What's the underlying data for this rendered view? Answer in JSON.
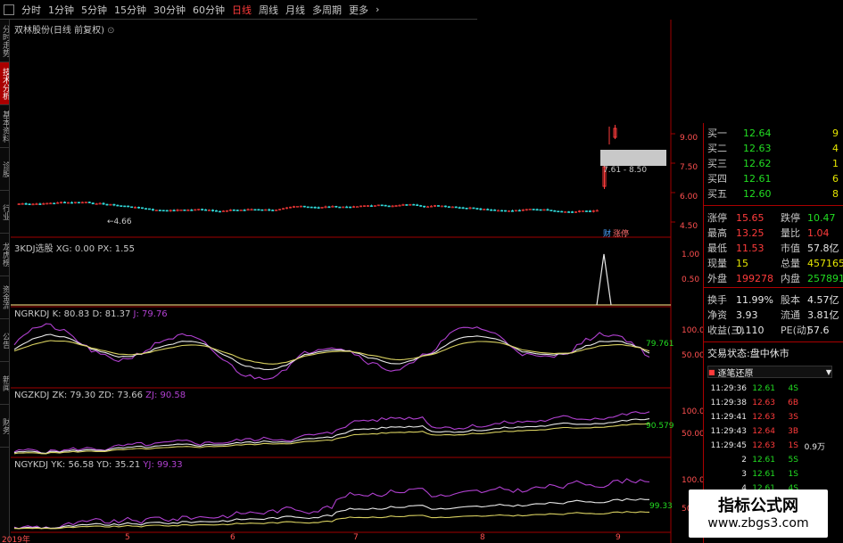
{
  "toolbar": {
    "items": [
      "分时",
      "1分钟",
      "5分钟",
      "15分钟",
      "30分钟",
      "60分钟",
      "日线",
      "周线",
      "月线",
      "多周期",
      "更多"
    ],
    "active_index": 6
  },
  "leftnav": {
    "items": [
      "分时走势",
      "技术分析",
      "基本资料",
      "诊股",
      "行业",
      "龙虎榜",
      "资金流",
      "公告",
      "新闻",
      "财务"
    ],
    "active_index": 1
  },
  "main_title": "双林股份(日线 前复权)",
  "price_axis": [
    "9.00",
    "7.50",
    "6.00",
    "4.50"
  ],
  "low_label": "4.66",
  "range_label": "7.61 - 8.50",
  "badge_left": "财",
  "badge_right": "涨停",
  "p2": {
    "title": "3KDJ选股 XG: 0.00 PX: 1.55",
    "axis": [
      "1.00",
      "0.50"
    ]
  },
  "p3": {
    "title": "NGRKDJ K: 80.83 D: 81.37",
    "j": "J: 79.76",
    "axis": [
      "100.0",
      "50.00"
    ],
    "last": "79.761"
  },
  "p4": {
    "title": "NGZKDJ ZK: 79.30 ZD: 73.66",
    "j": "ZJ: 90.58",
    "axis": [
      "100.0",
      "50.00"
    ],
    "last": "90.579"
  },
  "p5": {
    "title": "NGYKDJ YK: 56.58 YD: 35.21",
    "j": "YJ: 99.33",
    "axis": [
      "100.0",
      "50.00"
    ],
    "last": "99.33"
  },
  "date_axis": [
    "2019年",
    "5",
    "6",
    "7",
    "8",
    "9"
  ],
  "quote": {
    "top_ticks": [
      "9",
      "4",
      "1",
      "6",
      "8"
    ],
    "book": [
      {
        "label": "买一",
        "price": "12.64"
      },
      {
        "label": "买二",
        "price": "12.63"
      },
      {
        "label": "买三",
        "price": "12.62"
      },
      {
        "label": "买四",
        "price": "12.61"
      },
      {
        "label": "买五",
        "price": "12.60"
      }
    ],
    "stats": [
      {
        "l1": "涨停",
        "v1": "15.65",
        "c1": "red",
        "l2": "跌停",
        "v2": "10.47",
        "c2": "green"
      },
      {
        "l1": "最高",
        "v1": "13.25",
        "c1": "red",
        "l2": "量比",
        "v2": "1.04",
        "c2": "red"
      },
      {
        "l1": "最低",
        "v1": "11.53",
        "c1": "red",
        "l2": "市值",
        "v2": "57.8亿",
        "c2": "white"
      },
      {
        "l1": "现量",
        "v1": "15",
        "c1": "yellow",
        "l2": "总量",
        "v2": "457165",
        "c2": "yellow"
      },
      {
        "l1": "外盘",
        "v1": "199278",
        "c1": "red",
        "l2": "内盘",
        "v2": "257891",
        "c2": "green"
      }
    ],
    "stats2": [
      {
        "l1": "换手",
        "v1": "11.99%",
        "l2": "股本",
        "v2": "4.57亿"
      },
      {
        "l1": "净资",
        "v1": "3.93",
        "l2": "流通",
        "v2": "3.81亿"
      },
      {
        "l1": "收益(三)",
        "v1": "0.110",
        "l2": "PE(动)",
        "v2": "57.6"
      }
    ],
    "trade_status": "交易状态:盘中休市",
    "detail_header": "逐笔还原",
    "ticks": [
      {
        "time": "11:29:36",
        "price": "12.61",
        "c": "green",
        "vol": "4S",
        "extra": ""
      },
      {
        "time": "11:29:38",
        "price": "12.63",
        "c": "red",
        "vol": "6B",
        "extra": ""
      },
      {
        "time": "11:29:41",
        "price": "12.63",
        "c": "red",
        "vol": "3S",
        "extra": ""
      },
      {
        "time": "11:29:43",
        "price": "12.64",
        "c": "red",
        "vol": "3B",
        "extra": ""
      },
      {
        "time": "11:29:45",
        "price": "12.63",
        "c": "red",
        "vol": "1S",
        "extra": "0.9万"
      },
      {
        "time": "2",
        "price": "12.61",
        "c": "green",
        "vol": "5S",
        "extra": ""
      },
      {
        "time": "3",
        "price": "12.61",
        "c": "green",
        "vol": "1S",
        "extra": ""
      },
      {
        "time": "4",
        "price": "12.61",
        "c": "green",
        "vol": "4S",
        "extra": ""
      }
    ]
  },
  "watermark": {
    "title": "指标公式网",
    "url": "www.zbgs3.com"
  },
  "colors": {
    "up": "#ff3b3b",
    "down": "#33dddd",
    "line_white": "#e8e8e8",
    "line_purple": "#b040d0",
    "line_yellow": "#d8d060",
    "frame": "#a00000"
  }
}
